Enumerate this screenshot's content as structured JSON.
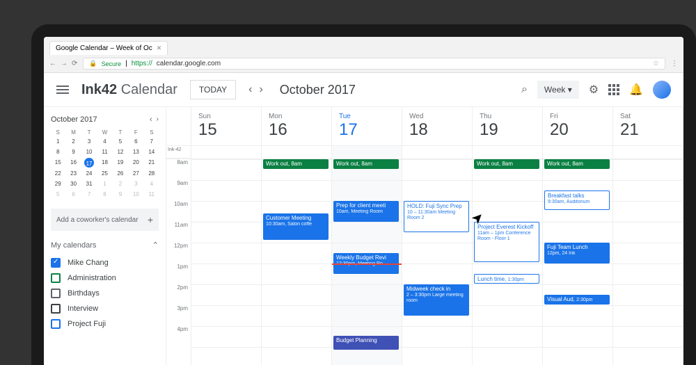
{
  "browser": {
    "tab_title": "Google Calendar – Week of Oc",
    "secure_label": "Secure",
    "url_prefix": "https://",
    "url": "calendar.google.com"
  },
  "header": {
    "brand_bold": "Ink42",
    "brand_text": "Calendar",
    "today": "TODAY",
    "month": "October 2017",
    "view": "Week"
  },
  "sidebar": {
    "mini_month": "October 2017",
    "dow": [
      "S",
      "M",
      "T",
      "W",
      "T",
      "F",
      "S"
    ],
    "days": [
      {
        "n": "1"
      },
      {
        "n": "2"
      },
      {
        "n": "3"
      },
      {
        "n": "4"
      },
      {
        "n": "5"
      },
      {
        "n": "6"
      },
      {
        "n": "7"
      },
      {
        "n": "8"
      },
      {
        "n": "9"
      },
      {
        "n": "10"
      },
      {
        "n": "11"
      },
      {
        "n": "12"
      },
      {
        "n": "13"
      },
      {
        "n": "14"
      },
      {
        "n": "15"
      },
      {
        "n": "16"
      },
      {
        "n": "17",
        "today": true
      },
      {
        "n": "18"
      },
      {
        "n": "19"
      },
      {
        "n": "20"
      },
      {
        "n": "21"
      },
      {
        "n": "22"
      },
      {
        "n": "23"
      },
      {
        "n": "24"
      },
      {
        "n": "25"
      },
      {
        "n": "26"
      },
      {
        "n": "27"
      },
      {
        "n": "28"
      },
      {
        "n": "29"
      },
      {
        "n": "30"
      },
      {
        "n": "31"
      },
      {
        "n": "1",
        "dim": true
      },
      {
        "n": "2",
        "dim": true
      },
      {
        "n": "3",
        "dim": true
      },
      {
        "n": "4",
        "dim": true
      },
      {
        "n": "5",
        "dim": true
      },
      {
        "n": "6",
        "dim": true
      },
      {
        "n": "7",
        "dim": true
      },
      {
        "n": "8",
        "dim": true
      },
      {
        "n": "9",
        "dim": true
      },
      {
        "n": "10",
        "dim": true
      },
      {
        "n": "11",
        "dim": true
      }
    ],
    "add_coworker": "Add a coworker's calendar",
    "my_calendars": "My calendars",
    "calendars": [
      {
        "name": "Mike Chang",
        "color": "#1a73e8",
        "checked": true
      },
      {
        "name": "Administration",
        "color": "#0b8043",
        "checked": false
      },
      {
        "name": "Birthdays",
        "color": "#5f6368",
        "checked": false
      },
      {
        "name": "Interview",
        "color": "#3c4043",
        "checked": false
      },
      {
        "name": "Project Fuji",
        "color": "#1a73e8",
        "checked": false
      }
    ]
  },
  "week": {
    "allday_label": "Ink-42",
    "days": [
      {
        "dow": "Sun",
        "date": "15"
      },
      {
        "dow": "Mon",
        "date": "16"
      },
      {
        "dow": "Tue",
        "date": "17",
        "active": true
      },
      {
        "dow": "Wed",
        "date": "18"
      },
      {
        "dow": "Thu",
        "date": "19"
      },
      {
        "dow": "Fri",
        "date": "20"
      },
      {
        "dow": "Sat",
        "date": "21"
      }
    ],
    "hours": [
      "8am",
      "9am",
      "10am",
      "11am",
      "12pm",
      "1pm",
      "2pm",
      "3pm",
      "4pm"
    ]
  },
  "events": {
    "mon_workout": {
      "title": "Work out,",
      "detail": "8am"
    },
    "tue_workout": {
      "title": "Work out,",
      "detail": "8am"
    },
    "thu_workout": {
      "title": "Work out,",
      "detail": "8am"
    },
    "fri_workout": {
      "title": "Work out,",
      "detail": "8am"
    },
    "fri_breakfast": {
      "title": "Breakfast talks",
      "detail": "9:30am, Auditorium"
    },
    "tue_prep": {
      "title": "Prep for client meeti",
      "detail": "10am, Meeting Room"
    },
    "mon_customer": {
      "title": "Customer Meeting",
      "detail": "10:30am, Salon coffe"
    },
    "wed_hold": {
      "title": "HOLD: Fuji Sync Prep",
      "detail": "10 – 11:30am\nMeeting Room 2"
    },
    "thu_everest": {
      "title": "Project Everest Kickoff",
      "detail": "11am – 1pm\nConference Room - Floor 1"
    },
    "fri_lunch": {
      "title": "Fuji Team Lunch",
      "detail": "12pm, 24 Ink"
    },
    "tue_budget": {
      "title": "Weekly Budget Revi",
      "detail": "12:30pm, Meeting Ro"
    },
    "thu_lunchtime": {
      "title": "Lunch time,",
      "detail": "1:30pm"
    },
    "wed_midweek": {
      "title": "Midweek check in",
      "detail": "2 – 3:30pm\nLarge meeting room"
    },
    "fri_visual": {
      "title": "Visual Aud,",
      "detail": "2:30pm"
    },
    "tue_planning": {
      "title": "Budget Planning",
      "detail": ""
    }
  }
}
